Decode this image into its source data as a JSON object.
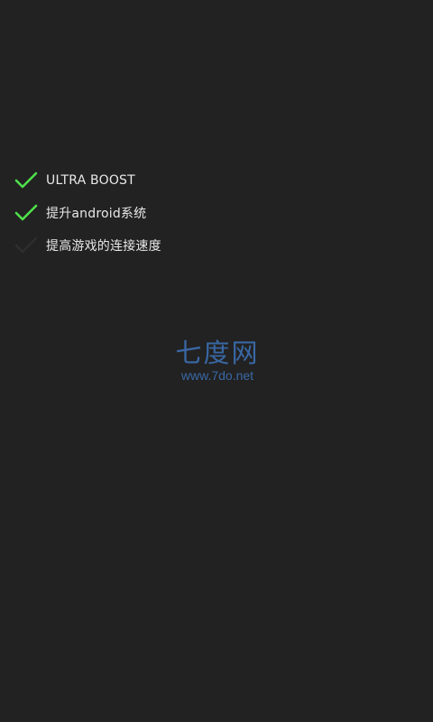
{
  "checklist": {
    "items": [
      {
        "label": "ULTRA BOOST",
        "checked": true
      },
      {
        "label": "提升android系统",
        "checked": true
      },
      {
        "label": "提高游戏的连接速度",
        "checked": false
      }
    ],
    "colors": {
      "checked": "#4ee14b",
      "unchecked": "#2e2e2e"
    }
  },
  "watermark": {
    "title": "七度网",
    "url": "www.7do.net",
    "color": "#3c6fb3"
  },
  "background_color": "#222222"
}
